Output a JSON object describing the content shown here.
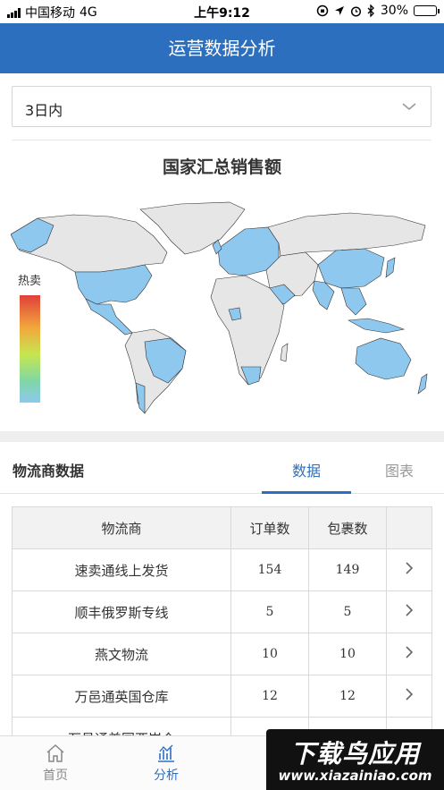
{
  "status_bar": {
    "carrier": "中国移动",
    "network": "4G",
    "time": "上午9:12",
    "battery": "30%",
    "battery_level": 0.3
  },
  "nav": {
    "title": "运营数据分析"
  },
  "filter": {
    "selected": "3日内"
  },
  "map": {
    "title": "国家汇总销售额",
    "legend_label": "热卖",
    "colors": {
      "sold": "#8ec8ef",
      "other": "#e6e6e6"
    }
  },
  "logistics": {
    "heading": "物流商数据",
    "tabs": [
      {
        "label": "数据",
        "active": true
      },
      {
        "label": "图表",
        "active": false
      }
    ],
    "columns": [
      "物流商",
      "订单数",
      "包裹数",
      ""
    ],
    "rows": [
      {
        "name": "速卖通线上发货",
        "orders": "154",
        "packages": "149"
      },
      {
        "name": "顺丰俄罗斯专线",
        "orders": "5",
        "packages": "5"
      },
      {
        "name": "燕文物流",
        "orders": "10",
        "packages": "10"
      },
      {
        "name": "万邑通英国仓库",
        "orders": "12",
        "packages": "12"
      },
      {
        "name": "万邑通美国西岸仓",
        "orders": "",
        "packages": ""
      }
    ]
  },
  "tabbar": {
    "home": "首页",
    "analysis": "分析"
  },
  "watermark": {
    "line1": "下载鸟应用",
    "line2": "www.xiazainiao.com"
  },
  "accent_color": "#2d6fbf"
}
